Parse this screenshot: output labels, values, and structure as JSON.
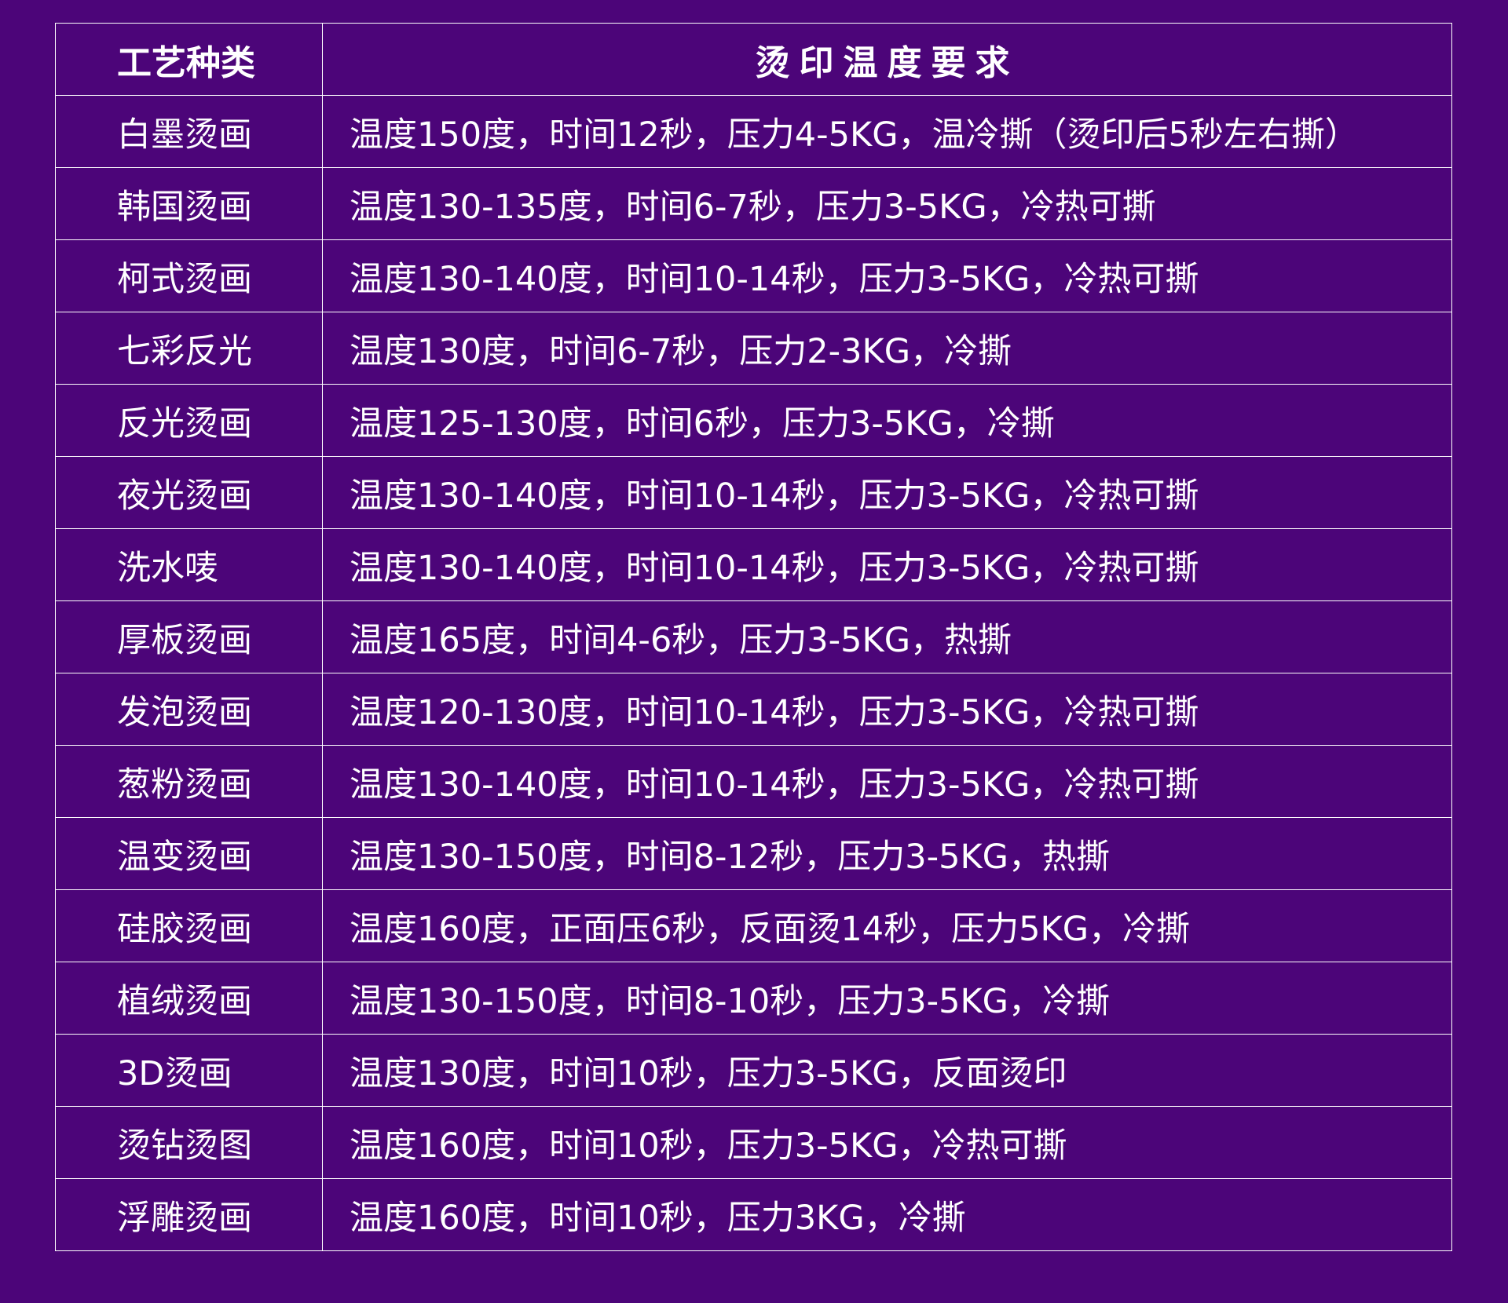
{
  "table": {
    "headers": [
      "工艺种类",
      "烫印温度要求"
    ],
    "rows": [
      {
        "craft": "白墨烫画",
        "requirement": "温度150度，时间12秒，压力4-5KG，温冷撕（烫印后5秒左右撕）"
      },
      {
        "craft": "韩国烫画",
        "requirement": "温度130-135度，时间6-7秒，压力3-5KG，冷热可撕"
      },
      {
        "craft": "柯式烫画",
        "requirement": "温度130-140度，时间10-14秒，压力3-5KG，冷热可撕"
      },
      {
        "craft": "七彩反光",
        "requirement": "温度130度，时间6-7秒，压力2-3KG，冷撕"
      },
      {
        "craft": "反光烫画",
        "requirement": "温度125-130度，时间6秒，压力3-5KG，冷撕"
      },
      {
        "craft": "夜光烫画",
        "requirement": "温度130-140度，时间10-14秒，压力3-5KG，冷热可撕"
      },
      {
        "craft": "洗水唛",
        "requirement": "温度130-140度，时间10-14秒，压力3-5KG，冷热可撕"
      },
      {
        "craft": "厚板烫画",
        "requirement": "温度165度，时间4-6秒，压力3-5KG，热撕"
      },
      {
        "craft": "发泡烫画",
        "requirement": "温度120-130度，时间10-14秒，压力3-5KG，冷热可撕"
      },
      {
        "craft": "葱粉烫画",
        "requirement": "温度130-140度，时间10-14秒，压力3-5KG，冷热可撕"
      },
      {
        "craft": "温变烫画",
        "requirement": "温度130-150度，时间8-12秒，压力3-5KG，热撕"
      },
      {
        "craft": "硅胶烫画",
        "requirement": "温度160度，正面压6秒，反面烫14秒，压力5KG，冷撕"
      },
      {
        "craft": "植绒烫画",
        "requirement": "温度130-150度，时间8-10秒，压力3-5KG，冷撕"
      },
      {
        "craft": "3D烫画",
        "requirement": "温度130度，时间10秒，压力3-5KG，反面烫印"
      },
      {
        "craft": "烫钻烫图",
        "requirement": "温度160度，时间10秒，压力3-5KG，冷热可撕"
      },
      {
        "craft": "浮雕烫画",
        "requirement": "温度160度，时间10秒，压力3KG，冷撕"
      }
    ]
  },
  "colors": {
    "background": "#4c0579",
    "text": "#ffffff",
    "border": "#ffffff"
  }
}
